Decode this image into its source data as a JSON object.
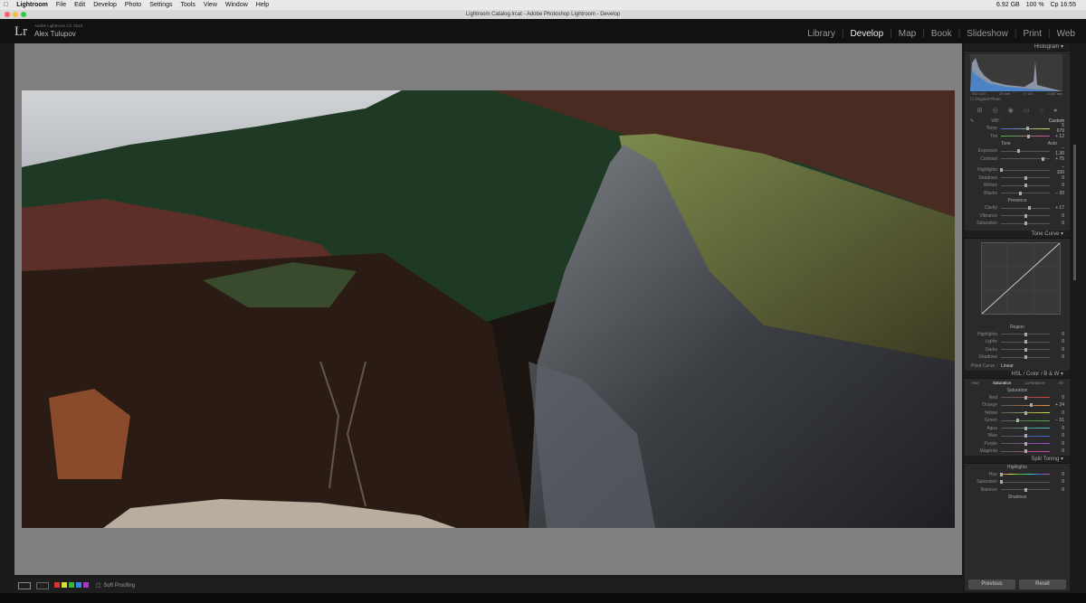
{
  "menubar": {
    "apple": "",
    "app": "Lightroom",
    "items": [
      "File",
      "Edit",
      "Develop",
      "Photo",
      "Settings",
      "Tools",
      "View",
      "Window",
      "Help"
    ],
    "status": [
      "6.92 GB",
      "100 %",
      "Ср 16:55"
    ]
  },
  "window_title": "Lightroom Catalog.lrcat - Adobe Photoshop Lightroom - Develop",
  "identity": {
    "logo": "Lr",
    "catalog": "Adobe Lightroom CC 2015",
    "user": "Alex Tulupov"
  },
  "modules": [
    "Library",
    "Develop",
    "Map",
    "Book",
    "Slideshow",
    "Print",
    "Web"
  ],
  "active_module": "Develop",
  "histogram": {
    "title": "Histogram",
    "readout": [
      "ISO 100",
      "24 mm",
      "f / 4.5",
      "1/160 sec"
    ],
    "original_photo": "Original Photo"
  },
  "basic": {
    "wb_label": "WB :",
    "wb_value": "Custom",
    "temp": {
      "label": "Temp",
      "value": "5 679",
      "pos": 0.55
    },
    "tint": {
      "label": "Tint",
      "value": "+ 12",
      "pos": 0.56
    },
    "tone_label": "Tone",
    "auto": "Auto",
    "exposure": {
      "label": "Exposure",
      "value": "− 1.30",
      "pos": 0.37
    },
    "contrast": {
      "label": "Contrast",
      "value": "+ 75",
      "pos": 0.87
    },
    "highlights": {
      "label": "Highlights",
      "value": "− 100",
      "pos": 0.0
    },
    "shadows": {
      "label": "Shadows",
      "value": "0",
      "pos": 0.5
    },
    "whites": {
      "label": "Whites",
      "value": "0",
      "pos": 0.5
    },
    "blacks": {
      "label": "Blacks",
      "value": "− 20",
      "pos": 0.4
    },
    "presence_label": "Presence",
    "clarity": {
      "label": "Clarity",
      "value": "+ 17",
      "pos": 0.58
    },
    "vibrance": {
      "label": "Vibrance",
      "value": "0",
      "pos": 0.5
    },
    "saturation": {
      "label": "Saturation",
      "value": "0",
      "pos": 0.5
    }
  },
  "tone_curve": {
    "title": "Tone Curve",
    "region": "Region",
    "highlights": {
      "label": "Highlights",
      "value": "0",
      "pos": 0.5
    },
    "lights": {
      "label": "Lights",
      "value": "0",
      "pos": 0.5
    },
    "darks": {
      "label": "Darks",
      "value": "0",
      "pos": 0.5
    },
    "shadows": {
      "label": "Shadows",
      "value": "0",
      "pos": 0.5
    },
    "point_curve": "Point Curve :",
    "point_value": "Linear"
  },
  "hsl": {
    "title": "HSL / Color / B & W",
    "tabs": [
      "Hue",
      "Saturation",
      "Luminance",
      "All"
    ],
    "active_tab": "Saturation",
    "section": "Saturation",
    "rows": [
      {
        "label": "Red",
        "value": "0",
        "pos": 0.5,
        "color": "#d44"
      },
      {
        "label": "Orange",
        "value": "+ 24",
        "pos": 0.62,
        "color": "#e83"
      },
      {
        "label": "Yellow",
        "value": "0",
        "pos": 0.5,
        "color": "#dd4"
      },
      {
        "label": "Green",
        "value": "− 31",
        "pos": 0.35,
        "color": "#4b4"
      },
      {
        "label": "Aqua",
        "value": "0",
        "pos": 0.5,
        "color": "#4cc"
      },
      {
        "label": "Blue",
        "value": "0",
        "pos": 0.5,
        "color": "#46d"
      },
      {
        "label": "Purple",
        "value": "0",
        "pos": 0.5,
        "color": "#a4d"
      },
      {
        "label": "Magenta",
        "value": "0",
        "pos": 0.5,
        "color": "#d4a"
      }
    ]
  },
  "split_toning": {
    "title": "Split Toning",
    "highlights": "Highlights",
    "hue": {
      "label": "Hue",
      "value": "0",
      "pos": 0.0
    },
    "saturation": {
      "label": "Saturation",
      "value": "0",
      "pos": 0.0
    },
    "balance": {
      "label": "Balance",
      "value": "0",
      "pos": 0.5
    },
    "shadows": "Shadows"
  },
  "buttons": {
    "previous": "Previous",
    "reset": "Reset"
  },
  "toolbar": {
    "soft_proofing": "Soft Proofing",
    "flags": [
      "#d33",
      "#dd3",
      "#3b3",
      "#38d",
      "#a3c"
    ]
  }
}
